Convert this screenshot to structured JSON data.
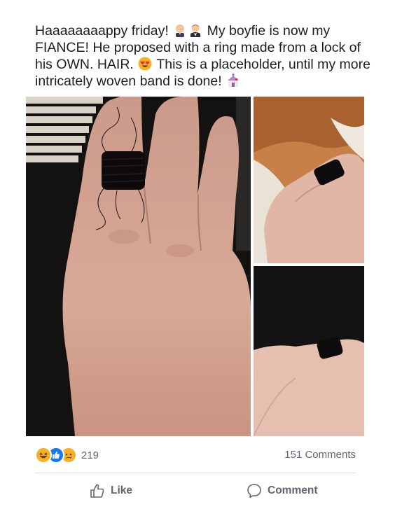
{
  "post": {
    "text_segments": [
      {
        "type": "text",
        "value": "Haaaaaaaappy friday! "
      },
      {
        "type": "emoji",
        "icon": "groom-emoji"
      },
      {
        "type": "emoji",
        "icon": "man-in-tuxedo-emoji"
      },
      {
        "type": "text",
        "value": " My boyfie is now my FIANCE! He proposed with a ring made from a lock of his OWN. HAIR. "
      },
      {
        "type": "emoji",
        "icon": "heart-eyes-emoji"
      },
      {
        "type": "text",
        "value": " This is a placeholder, until my more intricately woven band is done! "
      },
      {
        "type": "emoji",
        "icon": "wedding-chapel-emoji"
      }
    ]
  },
  "photos": [
    {
      "name": "hand-with-hair-ring-closeup"
    },
    {
      "name": "hand-with-hair-ring-on-fur"
    },
    {
      "name": "hand-with-hair-ring-dark"
    }
  ],
  "reactions": {
    "icons": [
      "laugh-reaction-icon",
      "like-reaction-icon",
      "sad-reaction-icon"
    ],
    "count": "219"
  },
  "comments": {
    "count_label": "151 Comments"
  },
  "actions": {
    "like_label": "Like",
    "comment_label": "Comment"
  },
  "colors": {
    "text": "#1c1e21",
    "secondary_text": "#606770",
    "like_blue": "#1877f2",
    "reaction_yellow": "#f7b125"
  }
}
